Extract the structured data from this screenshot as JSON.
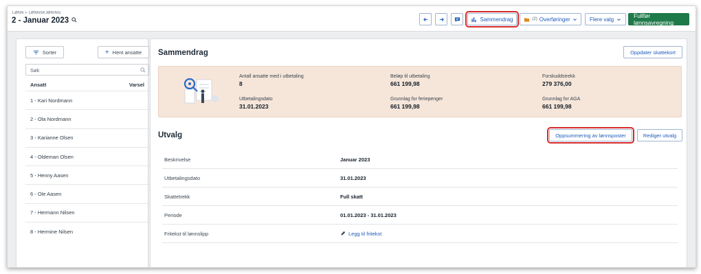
{
  "header": {
    "breadcrumb": "LØNN > LØNNSKJØRING",
    "title": "2 - Januar 2023",
    "buttons": {
      "summary": "Sammendrag",
      "transfers": "Overføringer",
      "transfers_count": "(2)",
      "more": "Flere valg",
      "complete": "Fullfør lønnsavregning"
    }
  },
  "sidebar": {
    "sort_label": "Sorter",
    "fetch_label": "Hent ansatte",
    "search_placeholder": "Søk",
    "col_employee": "Ansatt",
    "col_alert": "Varsel",
    "employees": [
      "1 - Kari Nordmann",
      "2 - Ola Nordmann",
      "3 - Karianne Olsen",
      "4 - Oldeman Olsen",
      "5 - Henny Aasen",
      "6 - Ole Aasen",
      "7 - Hermann Nilsen",
      "8 - Hermine Nilsen"
    ]
  },
  "summary": {
    "title": "Sammendrag",
    "update_tax_button": "Oppdater skattekort",
    "items": {
      "employees_with_payment": {
        "label": "Antall ansatte med i utbetaling",
        "value": "8"
      },
      "amount_to_pay": {
        "label": "Beløp til utbetaling",
        "value": "661 199,98"
      },
      "tax_deduction": {
        "label": "Forskuddstrekk",
        "value": "279 376,00"
      },
      "payment_date": {
        "label": "Utbetalingsdato",
        "value": "31.01.2023"
      },
      "holiday_basis": {
        "label": "Grunnlag for feriepenger",
        "value": "661 199,98"
      },
      "aga_basis": {
        "label": "Grunnlag for AGA",
        "value": "661 199,98"
      }
    }
  },
  "selection": {
    "title": "Utvalg",
    "summary_posts_button": "Oppsummering av lønnsposter",
    "edit_button": "Rediger utvalg",
    "rows": [
      {
        "key": "Beskrivelse",
        "value": "Januar 2023"
      },
      {
        "key": "Utbetalingsdato",
        "value": "31.01.2023"
      },
      {
        "key": "Skattetrekk",
        "value": "Full skatt"
      },
      {
        "key": "Periode",
        "value": "01.01.2023 - 31.01.2023"
      },
      {
        "key": "Fritekst til lønnslipp",
        "value": "Legg til fritekst"
      }
    ]
  },
  "colors": {
    "accent": "#1e5bb8",
    "green": "#1f7a4a",
    "highlight": "#d62a2a",
    "summary_bg": "#f6e6da"
  }
}
